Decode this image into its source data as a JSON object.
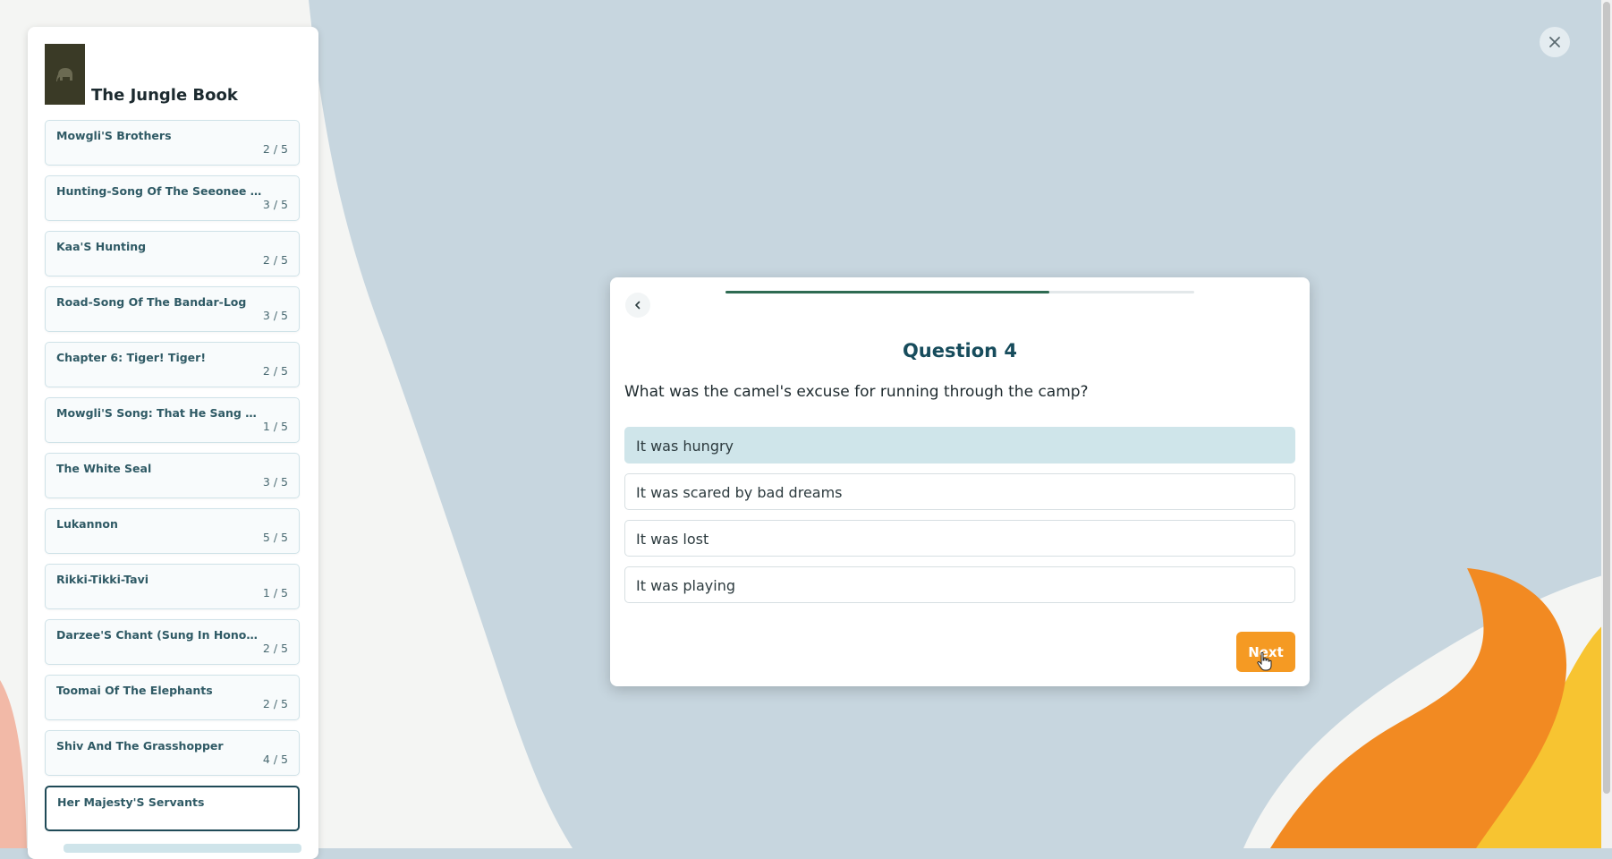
{
  "book": {
    "title": "The Jungle Book",
    "cover_icon": "elephant-icon"
  },
  "chapters": [
    {
      "name": "Mowgli'S Brothers",
      "score": "2 / 5"
    },
    {
      "name": "Hunting-Song Of The Seeonee Pa...",
      "score": "3 / 5"
    },
    {
      "name": "Kaa'S Hunting",
      "score": "2 / 5"
    },
    {
      "name": "Road-Song Of The Bandar-Log",
      "score": "3 / 5"
    },
    {
      "name": "Chapter 6: Tiger! Tiger!",
      "score": "2 / 5"
    },
    {
      "name": "Mowgli'S Song: That He Sang At Th...",
      "score": "1 / 5"
    },
    {
      "name": "The White Seal",
      "score": "3 / 5"
    },
    {
      "name": "Lukannon",
      "score": "5 / 5"
    },
    {
      "name": "Rikki-Tikki-Tavi",
      "score": "1 / 5"
    },
    {
      "name": "Darzee'S Chant (Sung In Honor Of ...",
      "score": "2 / 5"
    },
    {
      "name": "Toomai Of The Elephants",
      "score": "2 / 5"
    },
    {
      "name": "Shiv And The Grasshopper",
      "score": "4 / 5"
    },
    {
      "name": "Her Majesty'S Servants",
      "score": ""
    }
  ],
  "quiz": {
    "question_title": "Question 4",
    "question_text": "What was the camel's excuse for running through the camp?",
    "progress_fraction": 0.69,
    "options": [
      {
        "label": "It was hungry",
        "selected": true
      },
      {
        "label": "It was scared by bad dreams",
        "selected": false
      },
      {
        "label": "It was lost",
        "selected": false
      },
      {
        "label": "It was playing",
        "selected": false
      }
    ],
    "next_label": "Next",
    "back_icon": "chevron-left-icon",
    "close_icon": "close-icon"
  },
  "colors": {
    "accent_orange": "#f59a23",
    "title_teal": "#174c5c",
    "selected_option": "#cfe5ea",
    "progress_green": "#2e6b52",
    "background": "#c7d6df"
  }
}
